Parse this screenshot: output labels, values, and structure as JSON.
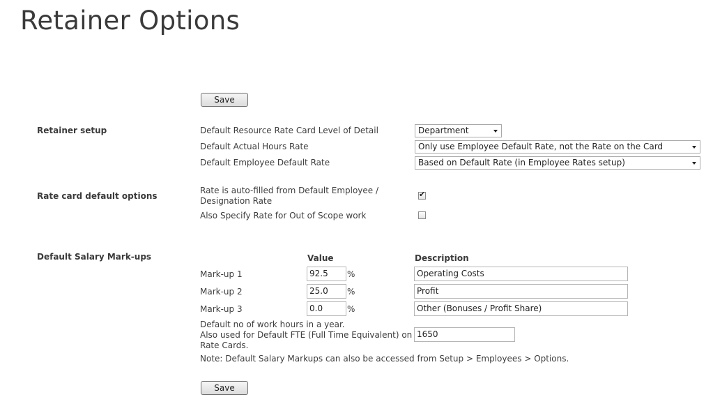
{
  "page": {
    "title": "Retainer Options"
  },
  "save_label": "Save",
  "retainer_setup": {
    "section_title": "Retainer setup",
    "level_of_detail": {
      "label": "Default Resource Rate Card Level of Detail",
      "value": "Department"
    },
    "actual_hours_rate": {
      "label": "Default Actual Hours Rate",
      "value": "Only use Employee Default Rate, not the Rate on the Card"
    },
    "employee_default_rate": {
      "label": "Default Employee Default Rate",
      "value": "Based on Default Rate (in Employee Rates setup)"
    }
  },
  "rate_card": {
    "section_title": "Rate card default options",
    "auto_filled": {
      "label_line1": "Rate is auto-filled from Default Employee /",
      "label_line2": "Designation Rate",
      "checked": true
    },
    "out_of_scope": {
      "label": "Also Specify Rate for Out of Scope work",
      "checked": false
    }
  },
  "markups": {
    "section_title": "Default Salary Mark-ups",
    "value_header": "Value",
    "description_header": "Description",
    "percent_symbol": "%",
    "rows": [
      {
        "label": "Mark-up 1",
        "value": "92.5",
        "description": "Operating Costs"
      },
      {
        "label": "Mark-up 2",
        "value": "25.0",
        "description": "Profit"
      },
      {
        "label": "Mark-up 3",
        "value": "0.0",
        "description": "Other (Bonuses / Profit Share)"
      }
    ],
    "work_hours": {
      "label_line1": "Default no of work hours in a year.",
      "label_line2": "Also used for Default FTE (Full Time Equivalent) on",
      "label_line3": "Rate Cards.",
      "value": "1650"
    },
    "note": "Note: Default Salary Markups can also be accessed from Setup > Employees > Options."
  }
}
